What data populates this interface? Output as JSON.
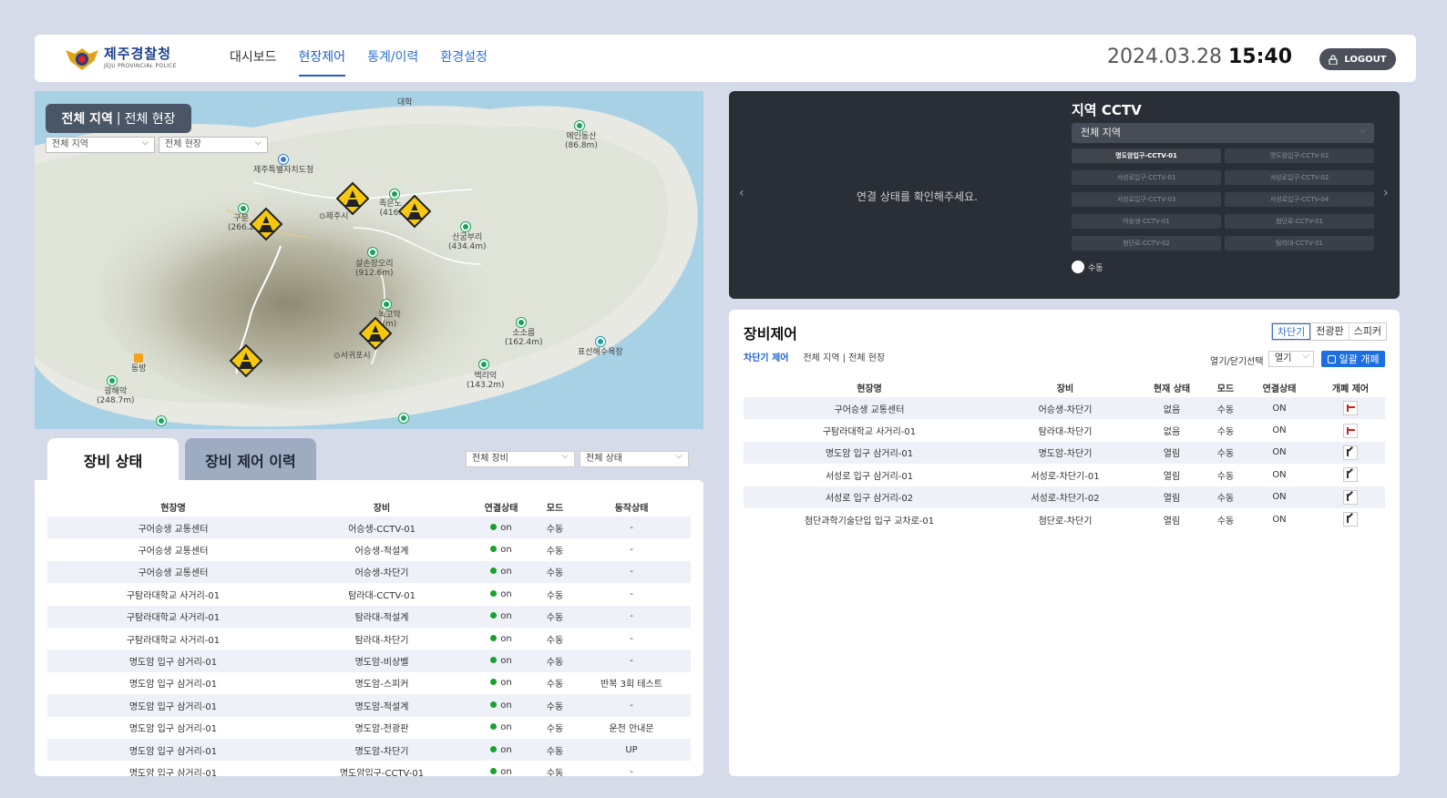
{
  "header": {
    "logo_title": "제주경찰청",
    "logo_subtitle": "JEJU PROVINCIAL POLICE",
    "nav": [
      "대시보드",
      "현장제어",
      "통계/이력",
      "환경설정"
    ],
    "date": "2024.03.28",
    "time": "15:40",
    "logout_label": "LOGOUT"
  },
  "map": {
    "scope_bold": "전체 지역",
    "scope_sep": "|",
    "scope_rest": "전체 현장",
    "select_region": "전체 지역",
    "select_site": "전체 현장",
    "labels": {
      "daehak": "대학",
      "office": "제주특별자치도청",
      "city": "⊙제주시",
      "jeolmul": "족은노",
      "jeolmul_h": "(416.",
      "gubong": "구분",
      "gubong_h": "(266.2",
      "sangumburi": "산굼부리",
      "sangumburi_h": "(434.4m)",
      "saljang": "살손장오리",
      "saljang_h": "(912.6m)",
      "mein": "메인동산",
      "mein_h": "(86.8m)",
      "nokgo": "녹고악",
      "nokgo_h": "(m)",
      "sosorum": "소소름",
      "sosorum_h": "(162.4m)",
      "pyoseon": "표선해수욕장",
      "baekyak": "백리악",
      "baekyak_h": "(143.2m)",
      "seogwipo": "⊙서귀포시",
      "gwangyak": "광해악",
      "gwangyak_h": "(248.7m)",
      "dongbang": "동방"
    }
  },
  "cctv": {
    "title": "지역 CCTV",
    "region": "전체 지역",
    "message": "연결 상태를 확인해주세요.",
    "cameras": [
      "명도암입구-CCTV-01",
      "명도암입구-CCTV-02",
      "서성로입구-CCTV-01",
      "서성로입구-CCTV-02",
      "서성로입구-CCTV-03",
      "서성로입구-CCTV-04",
      "어승생-CCTV-01",
      "첨단로-CCTV-01",
      "첨단로-CCTV-02",
      "탐라대-CCTV-01"
    ],
    "mode": "수동",
    "prev": "‹",
    "next": "›"
  },
  "control": {
    "title": "장비제어",
    "segments": [
      "차단기",
      "전광판",
      "스피커"
    ],
    "sub_active": "차단기 제어",
    "sub_scope": "전체 지역 | 전체 현장",
    "open_close_label": "열기/닫기선택",
    "open_close_value": "열기",
    "bulk_label": "일괄 개폐",
    "columns": [
      "현장명",
      "장비",
      "현재 상태",
      "모드",
      "연결상태",
      "개폐 제어"
    ],
    "rows": [
      [
        "구어승생 교통센터",
        "어승생-차단기",
        "없음",
        "수동",
        "ON"
      ],
      [
        "구탐라대학교 사거리-01",
        "탐라대-차단기",
        "없음",
        "수동",
        "ON"
      ],
      [
        "명도암 입구 삼거리-01",
        "명도암-차단기",
        "열림",
        "수동",
        "ON"
      ],
      [
        "서성로 입구 삼거리-01",
        "서성로-차단기-01",
        "열림",
        "수동",
        "ON"
      ],
      [
        "서성로 입구 삼거리-02",
        "서성로-차단기-02",
        "열림",
        "수동",
        "ON"
      ],
      [
        "첨단과학기술단입 입구 교차로-01",
        "첨단로-차단기",
        "열림",
        "수동",
        "ON"
      ]
    ]
  },
  "status": {
    "tab_active": "장비 상태",
    "tab_inactive": "장비 제어 이력",
    "select_device": "전체 장비",
    "select_state": "전체 상태",
    "columns": [
      "현장명",
      "장비",
      "연결상태",
      "모드",
      "동작상태"
    ],
    "rows": [
      [
        "구어승생 교통센터",
        "어승생-CCTV-01",
        "on",
        "수동",
        "-"
      ],
      [
        "구어승생 교통센터",
        "어승생-적설계",
        "on",
        "수동",
        "-"
      ],
      [
        "구어승생 교통센터",
        "어승생-차단기",
        "on",
        "수동",
        "-"
      ],
      [
        "구탐라대학교 사거리-01",
        "탐라대-CCTV-01",
        "on",
        "수동",
        "-"
      ],
      [
        "구탐라대학교 사거리-01",
        "탐라대-적설계",
        "on",
        "수동",
        "-"
      ],
      [
        "구탐라대학교 사거리-01",
        "탐라대-차단기",
        "on",
        "수동",
        "-"
      ],
      [
        "명도암 입구 삼거리-01",
        "명도암-비상벨",
        "on",
        "수동",
        "-"
      ],
      [
        "명도암 입구 삼거리-01",
        "명도암-스피커",
        "on",
        "수동",
        "반복 3회 테스트"
      ],
      [
        "명도암 입구 삼거리-01",
        "명도암-적설계",
        "on",
        "수동",
        "-"
      ],
      [
        "명도암 입구 삼거리-01",
        "명도암-전광판",
        "on",
        "수동",
        "운전 안내문"
      ],
      [
        "명도암 입구 삼거리-01",
        "명도암-차단기",
        "on",
        "수동",
        "UP"
      ],
      [
        "명도암 입구 삼거리-01",
        "명도암입구-CCTV-01",
        "on",
        "수동",
        "-"
      ]
    ]
  },
  "colors": {
    "accent": "#1d5fc9",
    "background": "#d5dbe9",
    "online": "#1aa02c",
    "cctv_bg": "#2a2f37"
  }
}
